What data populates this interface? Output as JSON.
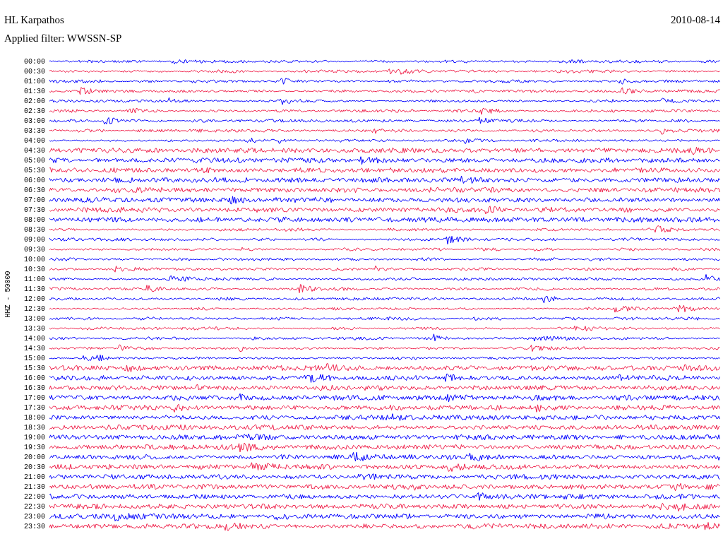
{
  "header": {
    "station": "HL Karpathos",
    "date": "2010-08-14",
    "filter": "Applied filter: WWSSN-SP"
  },
  "axis_label": "HHZ - 50000",
  "rows": [
    {
      "time": "00:00",
      "color": "#0000ff"
    },
    {
      "time": "00:30",
      "color": "#f0204a"
    },
    {
      "time": "01:00",
      "color": "#0000ff"
    },
    {
      "time": "01:30",
      "color": "#f0204a"
    },
    {
      "time": "02:00",
      "color": "#0000ff"
    },
    {
      "time": "02:30",
      "color": "#f0204a"
    },
    {
      "time": "03:00",
      "color": "#0000ff"
    },
    {
      "time": "03:30",
      "color": "#f0204a"
    },
    {
      "time": "04:00",
      "color": "#0000ff"
    },
    {
      "time": "04:30",
      "color": "#f0204a"
    },
    {
      "time": "05:00",
      "color": "#0000ff"
    },
    {
      "time": "05:30",
      "color": "#f0204a"
    },
    {
      "time": "06:00",
      "color": "#0000ff"
    },
    {
      "time": "06:30",
      "color": "#f0204a"
    },
    {
      "time": "07:00",
      "color": "#0000ff"
    },
    {
      "time": "07:30",
      "color": "#f0204a"
    },
    {
      "time": "08:00",
      "color": "#0000ff"
    },
    {
      "time": "08:30",
      "color": "#f0204a"
    },
    {
      "time": "09:00",
      "color": "#0000ff"
    },
    {
      "time": "09:30",
      "color": "#f0204a"
    },
    {
      "time": "10:00",
      "color": "#0000ff"
    },
    {
      "time": "10:30",
      "color": "#f0204a"
    },
    {
      "time": "11:00",
      "color": "#0000ff"
    },
    {
      "time": "11:30",
      "color": "#f0204a"
    },
    {
      "time": "12:00",
      "color": "#0000ff"
    },
    {
      "time": "12:30",
      "color": "#f0204a"
    },
    {
      "time": "13:00",
      "color": "#0000ff"
    },
    {
      "time": "13:30",
      "color": "#f0204a"
    },
    {
      "time": "14:00",
      "color": "#0000ff"
    },
    {
      "time": "14:30",
      "color": "#f0204a"
    },
    {
      "time": "15:00",
      "color": "#0000ff"
    },
    {
      "time": "15:30",
      "color": "#f0204a"
    },
    {
      "time": "16:00",
      "color": "#0000ff"
    },
    {
      "time": "16:30",
      "color": "#f0204a"
    },
    {
      "time": "17:00",
      "color": "#0000ff"
    },
    {
      "time": "17:30",
      "color": "#f0204a"
    },
    {
      "time": "18:00",
      "color": "#0000ff"
    },
    {
      "time": "18:30",
      "color": "#f0204a"
    },
    {
      "time": "19:00",
      "color": "#0000ff"
    },
    {
      "time": "19:30",
      "color": "#f0204a"
    },
    {
      "time": "20:00",
      "color": "#0000ff"
    },
    {
      "time": "20:30",
      "color": "#f0204a"
    },
    {
      "time": "21:00",
      "color": "#0000ff"
    },
    {
      "time": "21:30",
      "color": "#f0204a"
    },
    {
      "time": "22:00",
      "color": "#0000ff"
    },
    {
      "time": "22:30",
      "color": "#f0204a"
    },
    {
      "time": "23:00",
      "color": "#0000ff"
    },
    {
      "time": "23:30",
      "color": "#f0204a"
    }
  ]
}
